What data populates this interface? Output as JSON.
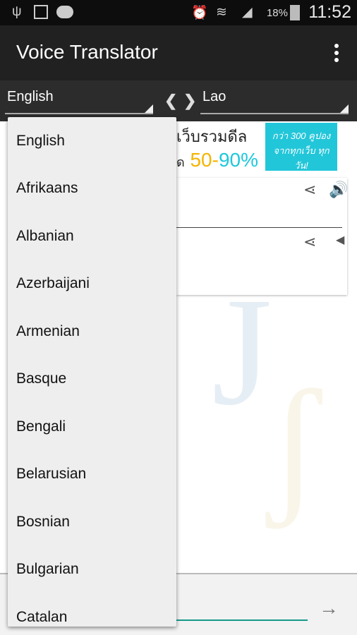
{
  "status_bar": {
    "time": "11:52",
    "battery": "18%",
    "icons": [
      "usb-icon",
      "image-icon",
      "message-icon",
      "alarm-icon",
      "wifi-icon",
      "signal-icon",
      "battery-charging-icon"
    ]
  },
  "app_bar": {
    "title": "Voice Translator",
    "menu_icon": "overflow-menu-icon"
  },
  "language_bar": {
    "source": "English",
    "target": "Lao",
    "swap_left": "❮",
    "swap_right": "❯"
  },
  "ad": {
    "line1": "เว็บรวมดีล",
    "prefix": "ด",
    "range_a": "50-",
    "range_b": "90%",
    "right_line1": "กว่า 300 คูปอง",
    "right_line2": "จากทุกเว็บ ทุกวัน!"
  },
  "dropdown": {
    "items": [
      "English",
      "Afrikaans",
      "Albanian",
      "Azerbaijani",
      "Armenian",
      "Basque",
      "Bengali",
      "Belarusian",
      "Bosnian",
      "Bulgarian",
      "Catalan"
    ]
  },
  "colors": {
    "accent": "#14998a",
    "app_bar": "#212121"
  }
}
